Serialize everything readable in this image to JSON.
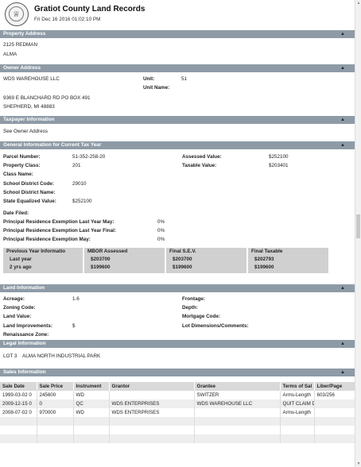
{
  "header": {
    "title": "Gratiot County Land Records",
    "timestamp": "Fri Dec 16 2016 01:02:10 PM"
  },
  "property_address": {
    "heading": "Property Address",
    "line1": "2125 REDMAN",
    "line2": "ALMA"
  },
  "owner_address": {
    "heading": "Owner Address",
    "owner": "WDS WAREHOUSE LLC",
    "unit_label": "Unit:",
    "unit_value": "51",
    "unit_name_label": "Unit Name:",
    "line2": "9369 E BLANCHARD RD PO BOX 491",
    "line3": "SHEPHERD, MI 48883"
  },
  "taxpayer_info": {
    "heading": "Taxpayer Information",
    "text": "See Owner Address"
  },
  "general_info": {
    "heading": "General Information for Current Tax Year",
    "parcel_label": "Parcel Number:",
    "parcel_value": "51-352-258-20",
    "assessed_label": "Assessed Value:",
    "assessed_value": "$252100",
    "class_label": "Property Class:",
    "class_value": "201",
    "taxable_label": "Taxable Value:",
    "taxable_value": "$203401",
    "class_name_label": "Class Name:",
    "school_code_label": "School District Code:",
    "school_code_value": "29010",
    "school_name_label": "School District Name:",
    "sev_label": "State Equalized Value:",
    "sev_value": "$252100",
    "date_filed_label": "Date Filed:",
    "pre_may_label": "Principal Residence Exemption Last Year May:",
    "pre_may_value": "0%",
    "pre_final_label": "Principal Residence Exemption Last Year Final:",
    "pre_final_value": "0%",
    "pre_cur_label": "Principal Residence Exemption May:",
    "pre_cur_value": "0%"
  },
  "prev_year": {
    "col1": "Previous Year Informatio",
    "col2": "MBOR Assessed",
    "col3": "Final S.E.V.",
    "col4": "Final Taxable",
    "rows": [
      {
        "label": "Last year",
        "mbor": "$203700",
        "sev": "$203700",
        "taxable": "$202793"
      },
      {
        "label": "2 yrs ago",
        "mbor": "$199600",
        "sev": "$199600",
        "taxable": "$199600"
      }
    ]
  },
  "land_info": {
    "heading": "Land Information",
    "acreage_label": "Acreage:",
    "acreage_value": "1.6",
    "frontage_label": "Frontage:",
    "zoning_label": "Zoning Code:",
    "depth_label": "Depth:",
    "land_value_label": "Land Value:",
    "mortgage_label": "Mortgage Code:",
    "improvements_label": "Land Improvements:",
    "improvements_value": "$",
    "lot_dims_label": "Lot Dimensions/Comments:",
    "renaissance_label": "Renaissance Zone:"
  },
  "legal_info": {
    "heading": "Legal Information",
    "text": "LOT 3    ALMA NORTH INDUSTRIAL PARK"
  },
  "sales_info": {
    "heading": "Sales Information",
    "columns": [
      "Sale Date",
      "Sale Price",
      "Instrument",
      "Grantor",
      "Grantee",
      "Terms of Sal",
      "Liber/Page"
    ],
    "rows": [
      [
        "1999-03-02 0",
        "245600",
        "WD",
        "",
        "SWITZER",
        "Arms-Length",
        "603/256"
      ],
      [
        "2009-12-15 0",
        "0",
        "QC",
        "WDS ENTERPRISES",
        "WDS WAREHOUSE LLC",
        "QUIT CLAIM D",
        ""
      ],
      [
        "2008-07-02 0",
        "970000",
        "WD",
        "WDS ENTERPRISES",
        "",
        "Arms-Length",
        ""
      ],
      [
        "",
        "",
        "",
        "",
        "",
        "",
        ""
      ],
      [
        "",
        "",
        "",
        "",
        "",
        "",
        ""
      ],
      [
        "",
        "",
        "",
        "",
        "",
        "",
        ""
      ]
    ]
  },
  "icons": {
    "collapse": "chevron-up-icon",
    "seal": "county-seal-icon"
  }
}
